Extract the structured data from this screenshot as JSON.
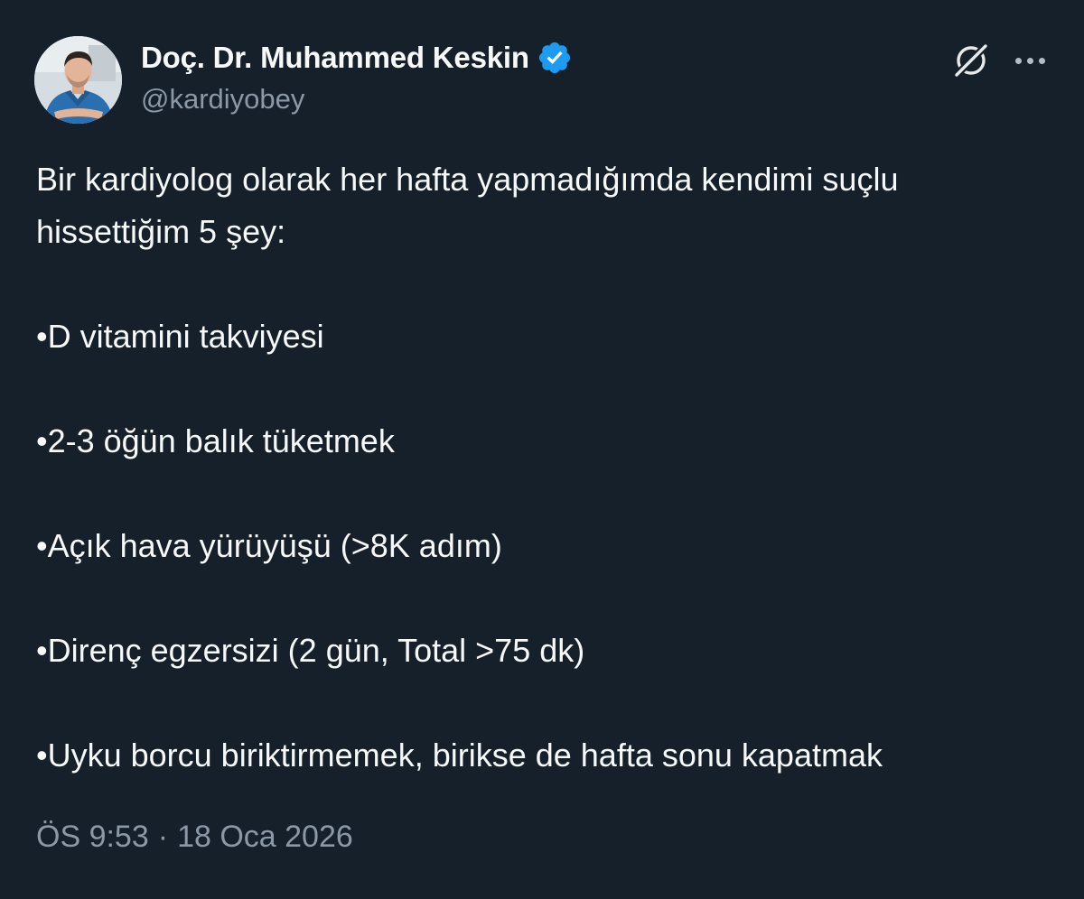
{
  "author": {
    "display_name": "Doç. Dr. Muhammed Keskin",
    "handle": "@kardiyobey",
    "verified": true,
    "verified_color": "#1d9bf0"
  },
  "actions": {
    "grok_icon": "grok-icon",
    "more_icon": "more-options-icon"
  },
  "tweet": {
    "intro_line1": "Bir kardiyolog olarak her hafta yapmadığımda kendimi suçlu",
    "intro_line2": "hissettiğim 5 şey:",
    "items": [
      "•D vitamini takviyesi",
      "•2-3 öğün balık tüketmek",
      "•Açık hava yürüyüşü (>8K adım)",
      "•Direnç egzersizi (2 gün, Total >75 dk)",
      "•Uyku borcu biriktirmemek, birikse de hafta sonu kapatmak"
    ]
  },
  "meta": {
    "time": "ÖS 9:53",
    "separator": "·",
    "date": "18 Oca 2026"
  },
  "colors": {
    "background": "#15202b",
    "text": "#f7f9f9",
    "secondary": "#8b98a5"
  }
}
